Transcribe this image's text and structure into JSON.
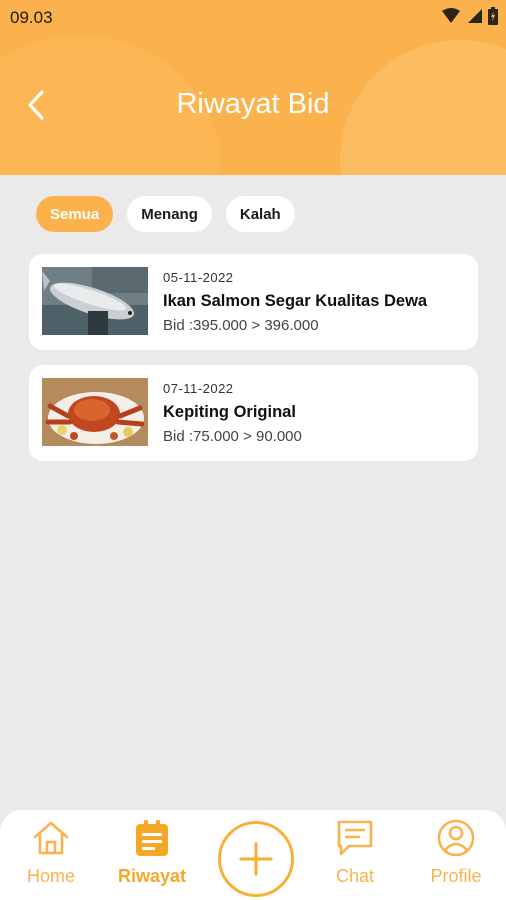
{
  "status_bar": {
    "time": "09.03"
  },
  "header": {
    "title": "Riwayat Bid"
  },
  "filters": [
    {
      "label": "Semua",
      "active": true
    },
    {
      "label": "Menang",
      "active": false
    },
    {
      "label": "Kalah",
      "active": false
    }
  ],
  "history": [
    {
      "date": "05-11-2022",
      "name": "Ikan Salmon Segar Kualitas Dewa",
      "bid": "Bid :395.000 > 396.000"
    },
    {
      "date": "07-11-2022",
      "name": "Kepiting Original",
      "bid": "Bid :75.000 > 90.000"
    }
  ],
  "bottom_nav": {
    "home": "Home",
    "riwayat": "Riwayat",
    "chat": "Chat",
    "profile": "Profile"
  },
  "colors": {
    "accent": "#fbb24d",
    "background": "#ebeaeb"
  }
}
